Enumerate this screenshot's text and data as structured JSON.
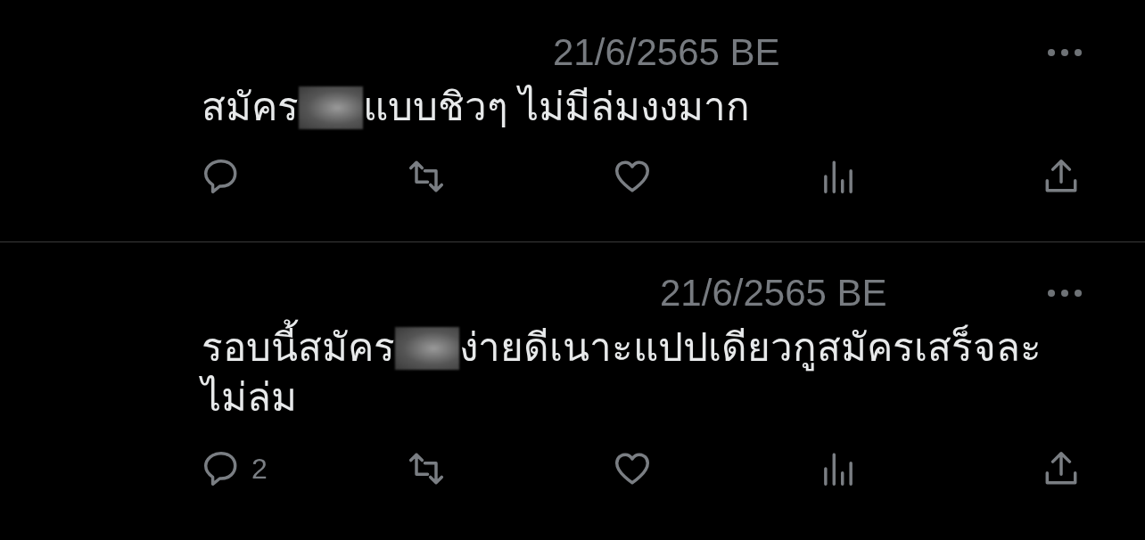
{
  "posts": [
    {
      "date": "21/6/2565 BE",
      "text_before": "สมัคร",
      "redacted": true,
      "text_after": [
        "แบบชิวๆ ไม่มีล่มงงมาก"
      ]
    },
    {
      "date": "21/6/2565 BE",
      "text_before": "รอบนี้สมัคร",
      "redacted": true,
      "text_after": [
        "ง่ายดีเนาะแปปเดียวกูสมัครเสร็จละ",
        "ไม่ล่ม"
      ],
      "reply_count": "2"
    }
  ]
}
